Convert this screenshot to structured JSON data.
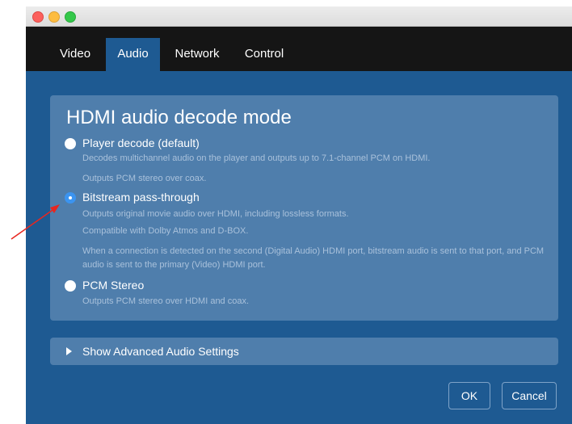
{
  "tabs": [
    {
      "label": "Video"
    },
    {
      "label": "Audio"
    },
    {
      "label": "Network"
    },
    {
      "label": "Control"
    }
  ],
  "panel": {
    "title": "HDMI audio decode mode",
    "options": [
      {
        "label": "Player decode (default)",
        "selected": false,
        "desc": [
          "Decodes multichannel audio on the player and outputs up to 7.1-channel PCM on HDMI.",
          "Outputs PCM stereo over coax."
        ]
      },
      {
        "label": "Bitstream pass-through",
        "selected": true,
        "desc": [
          "Outputs original movie audio over HDMI, including lossless formats.",
          "Compatible with Dolby Atmos and D-BOX.",
          "When a connection is detected on the second (Digital Audio) HDMI port, bitstream audio is sent to that port, and PCM audio is sent to the primary (Video) HDMI port."
        ]
      },
      {
        "label": "PCM Stereo",
        "selected": false,
        "desc": [
          "Outputs PCM stereo over HDMI and coax."
        ]
      }
    ]
  },
  "advanced": {
    "label": "Show Advanced Audio Settings"
  },
  "buttons": {
    "ok": "OK",
    "cancel": "Cancel"
  },
  "colors": {
    "window_bg": "#1e5a92",
    "panel_bg": "#4f7eac",
    "selected_radio": "#3b94f0",
    "annotation_arrow": "#e8261f"
  }
}
